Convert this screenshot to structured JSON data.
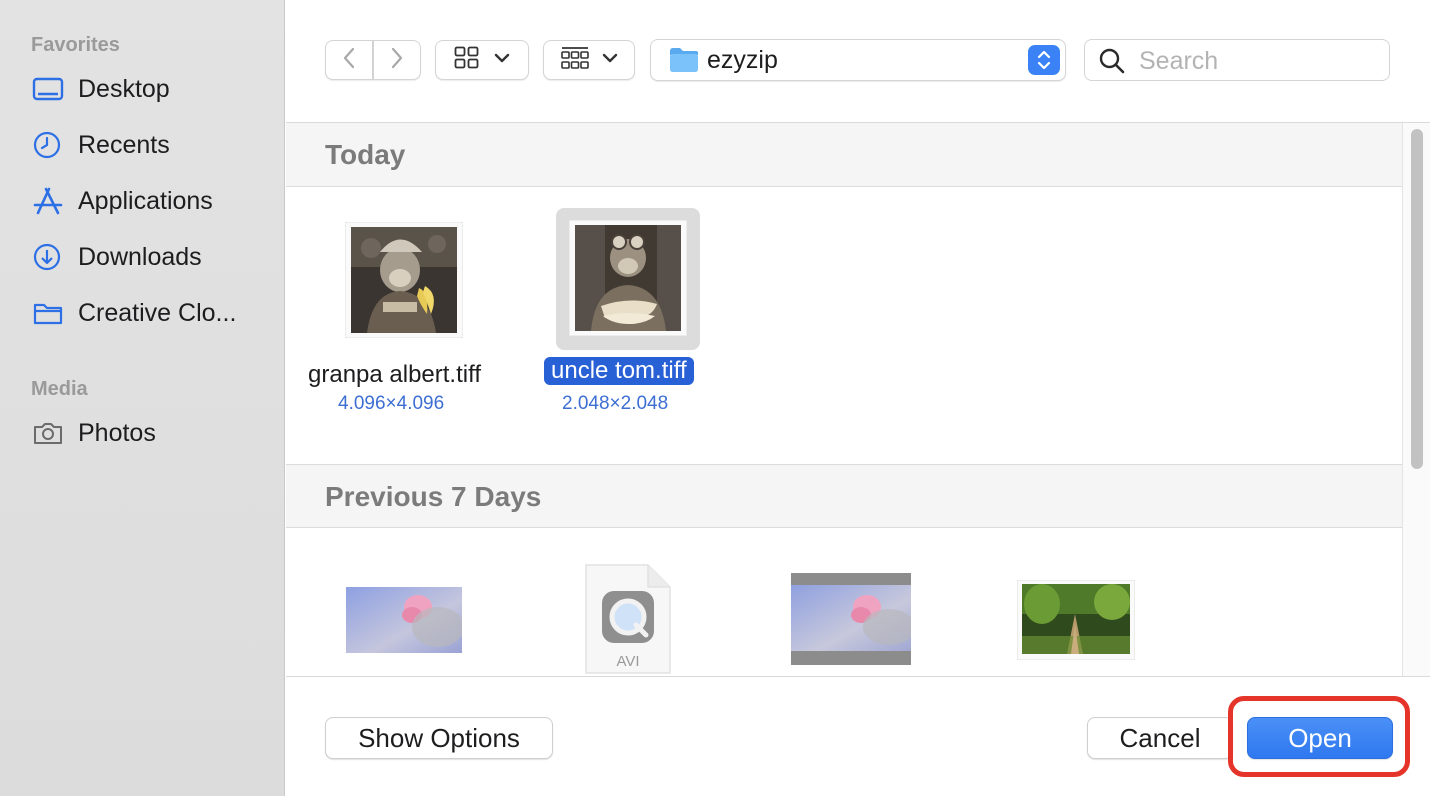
{
  "sidebar": {
    "favorites_heading": "Favorites",
    "favorites": [
      {
        "label": "Desktop",
        "icon": "desktop-icon"
      },
      {
        "label": "Recents",
        "icon": "clock-icon"
      },
      {
        "label": "Applications",
        "icon": "applications-icon"
      },
      {
        "label": "Downloads",
        "icon": "download-icon"
      },
      {
        "label": "Creative Clo...",
        "icon": "folder-icon"
      }
    ],
    "media_heading": "Media",
    "media": [
      {
        "label": "Photos",
        "icon": "camera-icon"
      }
    ]
  },
  "toolbar": {
    "back_icon": "chevron-left-icon",
    "forward_icon": "chevron-right-icon",
    "view_icon": "grid-view-icon",
    "group_icon": "group-view-icon",
    "location": "ezyzip",
    "search_placeholder": "Search"
  },
  "sections": [
    {
      "title": "Today",
      "files": [
        {
          "name": "granpa albert.tiff",
          "dims": "4.096×4.096",
          "selected": false
        },
        {
          "name": "uncle tom.tiff",
          "dims": "2.048×2.048",
          "selected": true
        }
      ]
    },
    {
      "title": "Previous 7 Days",
      "files": [
        {
          "name": "",
          "kind": "image"
        },
        {
          "name": "",
          "kind": "avi",
          "badge": "AVI"
        },
        {
          "name": "",
          "kind": "image"
        },
        {
          "name": "",
          "kind": "image"
        }
      ]
    }
  ],
  "footer": {
    "show_options": "Show Options",
    "cancel": "Cancel",
    "open": "Open"
  },
  "colors": {
    "accent": "#2f78ef",
    "selection": "#2860d6",
    "annotation_ring": "#e5352a"
  }
}
